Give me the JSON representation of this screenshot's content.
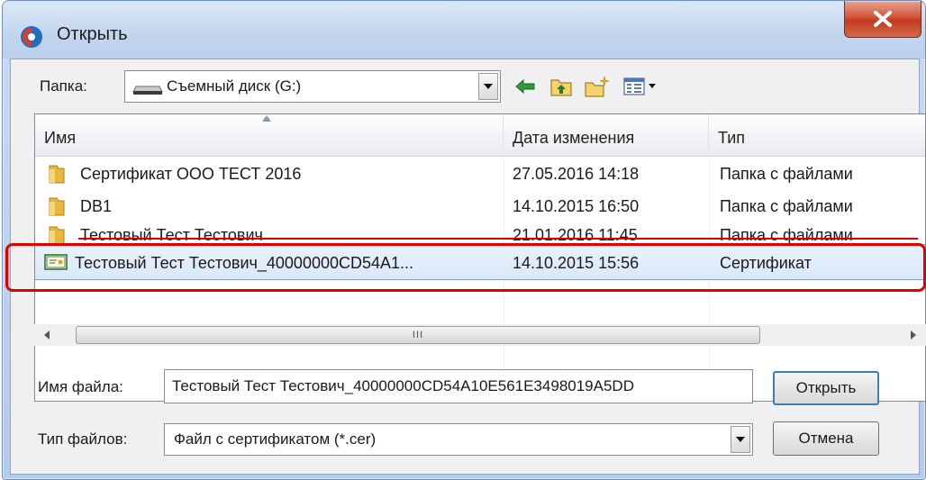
{
  "window": {
    "title": "Открыть",
    "close_glyph": "X"
  },
  "toolbar": {
    "folder_label": "Папка:",
    "folder_value": "Съемный диск (G:)",
    "icons": [
      "back-arrow-icon",
      "folder-up-icon",
      "new-folder-icon",
      "view-menu-icon"
    ]
  },
  "columns": {
    "name": "Имя",
    "date": "Дата изменения",
    "type": "Тип"
  },
  "files": [
    {
      "name": "Сертификат ООО ТЕСТ 2016",
      "date": "27.05.2016 14:18",
      "type": "Папка с файлами",
      "kind": "folder"
    },
    {
      "name": "DB1",
      "date": "14.10.2015 16:50",
      "type": "Папка с файлами",
      "kind": "folder"
    },
    {
      "name": "Тестовый Тест Тестович",
      "date": "21.01.2016 11:45",
      "type": "Папка с файлами",
      "kind": "folder"
    },
    {
      "name": "Тестовый Тест Тестович_40000000CD54A1...",
      "date": "14.10.2015 15:56",
      "type": "Сертификат",
      "kind": "certificate"
    }
  ],
  "scrollbar": {
    "thumb_glyph": "III"
  },
  "form": {
    "filename_label": "Имя файла:",
    "filename_value": "Тестовый Тест Тестович_40000000CD54A10E561E3498019A5DD",
    "filetype_label": "Тип файлов:",
    "filetype_value": "Файл с сертификатом (*.cer)",
    "open_button": "Открыть",
    "cancel_button": "Отмена"
  },
  "colors": {
    "highlight": "#e00000",
    "selection": "#d9e8fa",
    "close_button": "#c23a1c"
  }
}
